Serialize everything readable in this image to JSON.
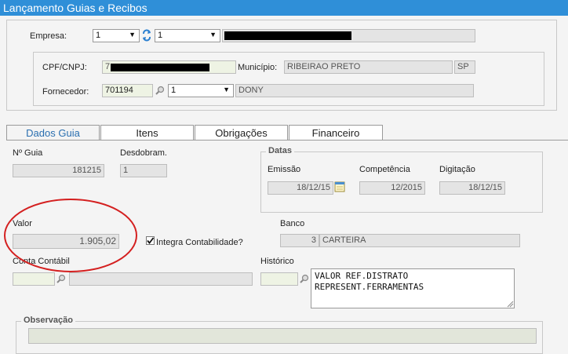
{
  "window": {
    "title": "Lançamento Guias e Recibos"
  },
  "header": {
    "empresa_label": "Empresa:",
    "empresa_select": "1",
    "filial_select": "1",
    "cpf_label": "CPF/CNPJ:",
    "cpf_value_prefix": "7",
    "municipio_label": "Município:",
    "municipio_value": "RIBEIRAO PRETO",
    "uf_value": "SP",
    "fornecedor_label": "Fornecedor:",
    "fornecedor_code": "701194",
    "fornecedor_select": "1",
    "fornecedor_name": "DONY"
  },
  "tabs": [
    {
      "label": "Dados Guia",
      "active": true
    },
    {
      "label": "Itens",
      "active": false
    },
    {
      "label": "Obrigações",
      "active": false
    },
    {
      "label": "Financeiro",
      "active": false
    }
  ],
  "guia": {
    "numero_label": "Nº Guia",
    "numero_value": "181215",
    "desdobram_label": "Desdobram.",
    "desdobram_value": "1",
    "datas_legend": "Datas",
    "emissao_label": "Emissão",
    "emissao_value": "18/12/15",
    "competencia_label": "Competência",
    "competencia_value": "12/2015",
    "digitacao_label": "Digitação",
    "digitacao_value": "18/12/15",
    "valor_label": "Valor",
    "valor_value": "1.905,02",
    "integra_label": "Integra Contabilidade?",
    "integra_checked": true,
    "banco_label": "Banco",
    "banco_code": "3",
    "banco_name": "CARTEIRA",
    "conta_label": "Conta Contábil",
    "historico_label": "Histórico",
    "historico_value": "VALOR REF.DISTRATO\nREPRESENT.FERRAMENTAS",
    "observacao_legend": "Observação"
  },
  "colors": {
    "titlebar": "#2f8fd8",
    "annotation_circle": "#d42020",
    "active_tab_text": "#2a6fb0"
  }
}
